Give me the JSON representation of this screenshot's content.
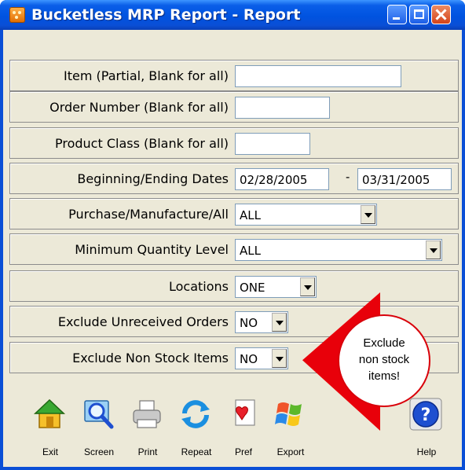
{
  "window": {
    "title": "Bucketless MRP Report - Report"
  },
  "form": {
    "item_label": "Item (Partial, Blank for all)",
    "item_value": "",
    "order_label": "Order Number (Blank for all)",
    "order_value": "",
    "class_label": "Product Class (Blank for all)",
    "class_value": "",
    "dates_label": "Beginning/Ending Dates",
    "begin_date": "02/28/2005",
    "date_separator": "-",
    "end_date": "03/31/2005",
    "pma_label": "Purchase/Manufacture/All",
    "pma_value": "ALL",
    "minqty_label": "Minimum Quantity Level",
    "minqty_value": "ALL",
    "locations_label": "Locations",
    "locations_value": "ONE",
    "unreceived_label": "Exclude Unreceived Orders",
    "unreceived_value": "NO",
    "nonstock_label": "Exclude Non Stock Items",
    "nonstock_value": "NO"
  },
  "callout": {
    "line1": "Exclude",
    "line2": "non stock",
    "line3": "items!"
  },
  "toolbar": {
    "exit": "Exit",
    "screen": "Screen",
    "print": "Print",
    "repeat": "Repeat",
    "pref": "Pref",
    "export": "Export",
    "help": "Help"
  },
  "icons": [
    "house-icon",
    "magnifier-screen-icon",
    "printer-icon",
    "repeat-arrows-icon",
    "heart-document-icon",
    "windows-flag-icon",
    "help-question-icon"
  ],
  "colors": {
    "titlebar": "#0a4fd6",
    "window_bg": "#ece9d8",
    "callout_red": "#e8000a",
    "help_blue": "#1e4fd0"
  }
}
